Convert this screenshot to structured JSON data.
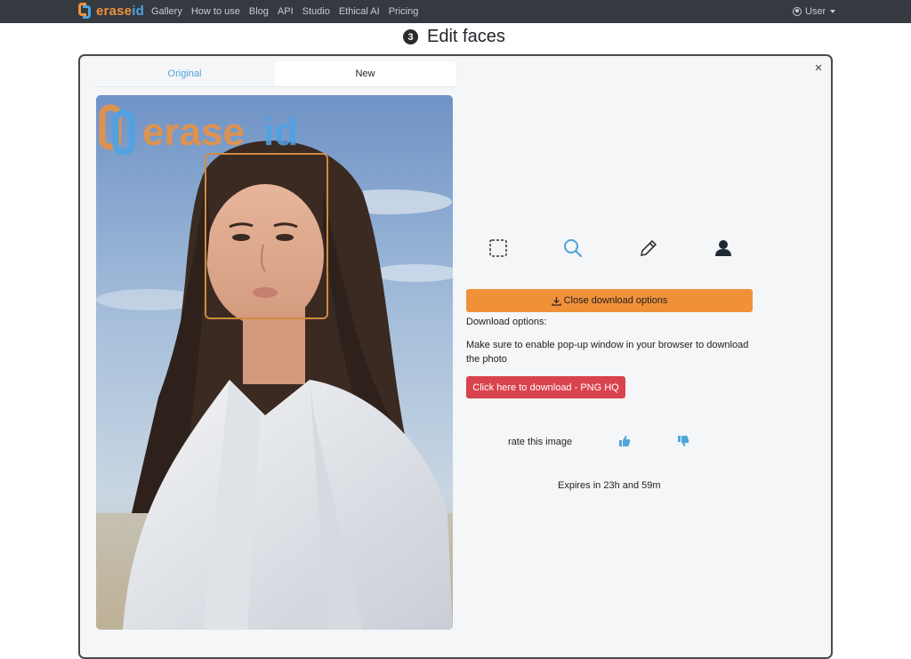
{
  "navbar": {
    "brand_part1": "erase",
    "brand_part2": "id",
    "links": [
      "Gallery",
      "How to use",
      "Blog",
      "API",
      "Studio",
      "Ethical AI",
      "Pricing"
    ],
    "user_label": "User"
  },
  "heading": {
    "step_number": "3",
    "title": "Edit faces"
  },
  "modal": {
    "close_label": "×",
    "tabs": {
      "original": "Original",
      "new": "New"
    },
    "watermark": {
      "part1": "erase",
      "part2": "id"
    },
    "tools": [
      "select-area",
      "search",
      "pencil",
      "person"
    ],
    "close_download_button": "Close download options",
    "download_options_label": "Download options:",
    "popup_note": "Make sure to enable pop-up window in your browser to download the photo",
    "download_png_button": "Click here to download - PNG HQ",
    "rate_label": "rate this image",
    "expires_text": "Expires in 23h and 59m"
  },
  "colors": {
    "brand_orange": "#f0913a",
    "brand_blue": "#4da3e6",
    "danger": "#d9434e",
    "navbar": "#343a40"
  }
}
